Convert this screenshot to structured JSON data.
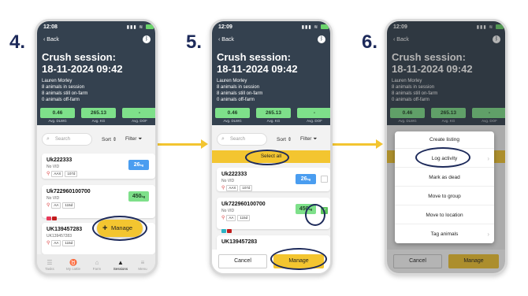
{
  "steps": [
    "4.",
    "5.",
    "6."
  ],
  "colors": {
    "header": "#34414f",
    "accent_yellow": "#f3c530",
    "stat_green": "#7ee08a",
    "weight_blue": "#4a9df0",
    "step_navy": "#1d2a5a"
  },
  "status": {
    "time": "12:08",
    "time_3": "12:09",
    "time_2": "12:09",
    "icons": "▮▮▮ ≋"
  },
  "header": {
    "back_label": "Back",
    "bluetooth_icon": "bluetooth-icon",
    "title_line1": "Crush session:",
    "title_line2": "18-11-2024 09:42",
    "owner": "Lauren Morley",
    "in_session": "8 animals in session",
    "on_farm": "8 animals still on-farm",
    "off_farm": "0 animals off-farm"
  },
  "stats": [
    {
      "value": "0.46",
      "label": "Avg. DLWG"
    },
    {
      "value": "265.13",
      "label": "Avg. KG"
    },
    {
      "value": "-",
      "label": "Avg. DOF"
    }
  ],
  "search": {
    "placeholder": "Search",
    "sort_label": "Sort ⇕",
    "filter_label": "Filter ⏷"
  },
  "animals": [
    {
      "tag": "Uk222333",
      "sub": "No VID",
      "chips": [
        "AAX",
        "107d"
      ],
      "weight": "26",
      "unit": "kg"
    },
    {
      "tag": "Uk722960100700",
      "sub": "No VID",
      "chips": [
        "AA",
        "115d"
      ],
      "weight": "450",
      "unit": "kg"
    },
    {
      "tag": "UK139457283",
      "sub": "UK139457283",
      "chips": [
        "AA",
        "115d"
      ],
      "weight": "",
      "unit": ""
    }
  ],
  "tabbar": [
    {
      "label": "Tasks",
      "icon": "tasks-icon"
    },
    {
      "label": "My cattle",
      "icon": "cattle-icon"
    },
    {
      "label": "Farm",
      "icon": "farm-icon"
    },
    {
      "label": "Sessions",
      "icon": "sessions-icon"
    },
    {
      "label": "Menu",
      "icon": "menu-icon"
    }
  ],
  "fab": {
    "plus": "+",
    "label": "Manage"
  },
  "select_all_label": "Select all",
  "checkmark": "✓",
  "actions": {
    "cancel": "Cancel",
    "manage": "Manage"
  },
  "menu_items": [
    "Create listing",
    "Log activity",
    "Mark as dead",
    "Move to group",
    "Move to location",
    "Tag animals"
  ]
}
